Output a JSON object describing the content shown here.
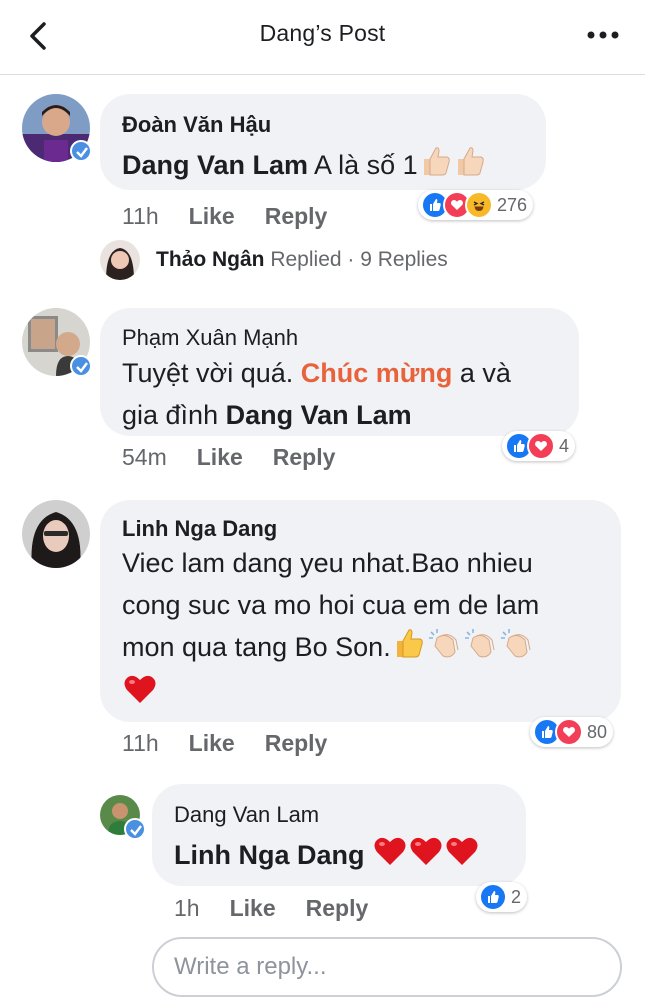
{
  "header": {
    "title": "Dang’s Post"
  },
  "comments": [
    {
      "author": "Đoàn Văn Hậu",
      "tag": "Dang Van Lam",
      "text": " A là số 1",
      "time": "11h",
      "like": "Like",
      "reply": "Reply",
      "reactions": [
        "like",
        "love",
        "haha"
      ],
      "reaction_count": "276",
      "replied": {
        "name": "Thảo Ngân",
        "action": " Replied",
        "count": " · 9 Replies"
      }
    },
    {
      "author": "Phạm Xuân Mạnh",
      "text_line1_a": "Tuyệt vời quá. ",
      "text_line1_tag": "Chúc mừng",
      "text_line1_b": " a và",
      "text_line2_a": "gia đình ",
      "text_line2_tag": "Dang Van Lam",
      "time": "54m",
      "like": "Like",
      "reply": "Reply",
      "reactions": [
        "like",
        "love"
      ],
      "reaction_count": "4"
    },
    {
      "author": "Linh Nga Dang",
      "line1": "Viec lam dang yeu nhat.Bao nhieu",
      "line2": "cong suc va mo hoi cua em de lam",
      "line3": "mon qua tang Bo Son.",
      "time": "11h",
      "like": "Like",
      "reply": "Reply",
      "reactions": [
        "like",
        "love"
      ],
      "reaction_count": "80"
    },
    {
      "author": "Dang Van Lam",
      "tag": "Linh Nga Dang",
      "time": "1h",
      "like": "Like",
      "reply": "Reply",
      "reactions": [
        "like"
      ],
      "reaction_count": "2"
    }
  ],
  "input": {
    "placeholder": "Write a reply..."
  },
  "colors": {
    "like": "#1877f2",
    "love": "#f33e58",
    "haha": "#f7b928",
    "tag": "#e8623b",
    "verified": "#4a90e2"
  },
  "icons": [
    "back-arrow-icon",
    "more-dots-icon",
    "verified-badge-icon",
    "thumbs-up-emoji",
    "clapping-hands-emoji",
    "heart-emoji"
  ]
}
